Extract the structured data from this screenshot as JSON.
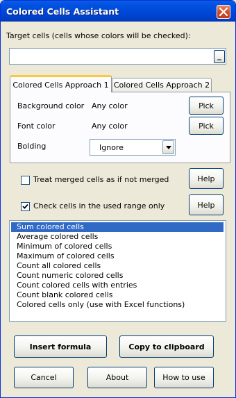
{
  "window": {
    "title": "Colored Cells Assistant"
  },
  "target": {
    "label": "Target cells (cells whose colors will be checked):",
    "value": "",
    "picker_label": "_"
  },
  "tabs": [
    {
      "label": "Colored Cells Approach 1",
      "active": true
    },
    {
      "label": "Colored Cells Approach 2",
      "active": false
    }
  ],
  "approach1": {
    "background": {
      "label": "Background color",
      "value": "Any color",
      "button": "Pick"
    },
    "font": {
      "label": "Font color",
      "value": "Any color",
      "button": "Pick"
    },
    "bolding": {
      "label": "Bolding",
      "selected": "Ignore"
    }
  },
  "options": {
    "merged": {
      "label": "Treat merged cells as if not merged",
      "checked": false,
      "help": "Help"
    },
    "used_range": {
      "label": "Check cells in the used range only",
      "checked": true,
      "help": "Help"
    }
  },
  "functions": {
    "items": [
      "Sum colored cells",
      "Average colored cells",
      "Minimum of colored cells",
      "Maximum of colored cells",
      "Count all colored cells",
      "Count numeric colored cells",
      "Count colored cells with entries",
      "Count blank colored cells",
      "Colored cells only (use with Excel functions)"
    ],
    "selected_index": 0
  },
  "buttons": {
    "insert_formula": "Insert formula",
    "copy_clipboard": "Copy to clipboard",
    "cancel": "Cancel",
    "about": "About",
    "how_to_use": "How to use"
  },
  "colors": {
    "title_bar": "#0052e0",
    "selection": "#316ac5",
    "face": "#ece9d8",
    "tab_accent": "#ffc83c"
  }
}
